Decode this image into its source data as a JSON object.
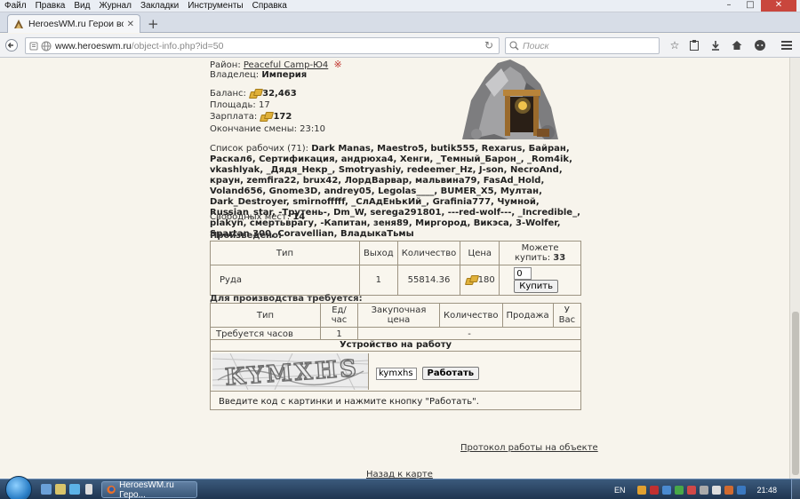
{
  "menu": [
    "Файл",
    "Правка",
    "Вид",
    "Журнал",
    "Закладки",
    "Инструменты",
    "Справка"
  ],
  "tab": {
    "title": "HeroesWM.ru Герои войн..."
  },
  "nav": {
    "url_domain": "www.heroeswm.ru",
    "url_path": "/object-info.php?id=50",
    "search_placeholder": "Поиск"
  },
  "info": {
    "district_label": "Район:",
    "district_value": "Peaceful Camp-Ю4",
    "owner_label": "Владелец:",
    "owner_value": "Империя",
    "balance_label": "Баланс:",
    "balance_value": "32,463",
    "area_label": "Площадь:",
    "area_value": "17",
    "salary_label": "Зарплата:",
    "salary_value": "172",
    "shift_end_label": "Окончание смены:",
    "shift_end_value": "23:10"
  },
  "workers": {
    "label": "Список рабочих (71):",
    "names": "Dark Manas, Maestro5, butik555, Rexarus, Байран, Раскал6, Сертификация, андрюха4, Хенги, _Темный_Барон_, _Rom4ik, vkashlyak, _Дядя_Некр_, Smotryashiy, redeemer_Hz, J-son, NecroAnd, краун, zemfira22, brux42, ЛордВарвар, мальвина79, FasAd_Hold, Voland656, Gnome3D, andrey05, Legolas____, BUMER_X5, Мултан, Dark_Destroyer, smirnofffff, _СлАдЕнЬкИй_, Grafinia777, Чумной, Russian_star, -Трутень-, Dm_W, serega291801, ---red-wolf---, _Incredible_, plakyn, смертьврагу, -Капитан, зеня89, Миргород, Викэса, 3-Wolfer, Spartan 300, Coravellian, ВладыкаТьмы",
    "free_label": "Свободных мест:",
    "free_value": "14"
  },
  "produced": {
    "title": "Произведено:",
    "headers": [
      "Тип",
      "Выход",
      "Количество",
      "Цена",
      "Можете купить:"
    ],
    "can_buy": "33",
    "row": {
      "type": "Руда",
      "output": "1",
      "quantity": "55814.36",
      "price": "180",
      "buy_qty": "0",
      "buy_label": "Купить"
    }
  },
  "required": {
    "title": "Для производства требуется:",
    "headers": [
      "Тип",
      "Ед/час",
      "Закупочная цена",
      "Количество",
      "Продажа",
      "У Вас"
    ],
    "row": {
      "type": "Требуется часов",
      "per_hour": "1",
      "rest": "-"
    }
  },
  "job": {
    "title": "Устройство на работу",
    "captcha_text": "KYMXHS",
    "code_value": "kymxhs",
    "work_label": "Работать",
    "hint": "Введите код с картинки и нажмите кнопку \"Работать\"."
  },
  "links": {
    "protocol": "Протокол работы на объекте",
    "back": "Назад к карте"
  },
  "taskbar": {
    "task_label": "HeroesWM.ru Геро...",
    "lang": "EN",
    "time": "21:48"
  }
}
